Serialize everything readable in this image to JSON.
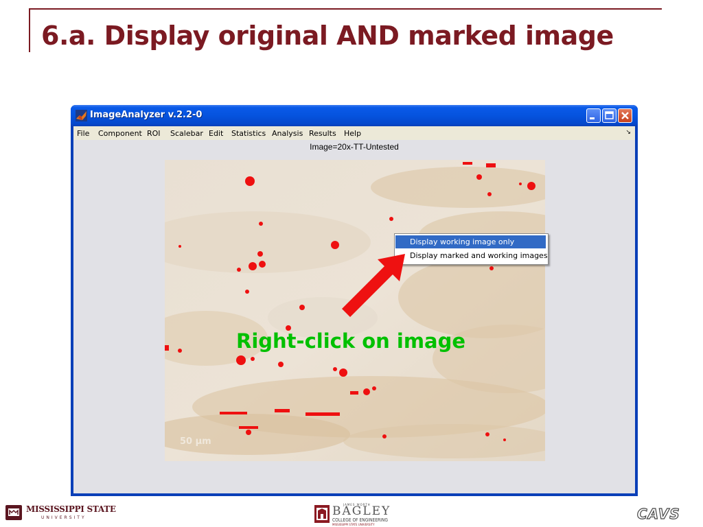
{
  "slide": {
    "title": "6.a. Display original AND marked image",
    "callout": "Right-click on image",
    "accent_color": "#7b1a22",
    "callout_color": "#00c000",
    "arrow_color": "#ee1111"
  },
  "window": {
    "title": "ImageAnalyzer v.2.2-0",
    "menu": [
      "File",
      "Component",
      "ROI",
      "Scalebar",
      "Edit",
      "Statistics",
      "Analysis",
      "Results",
      "Help"
    ],
    "image_title": "Image=20x-TT-Untested",
    "scale_label": "50 µm",
    "titlebar_color": "#0553de",
    "selection_color": "#316ac5"
  },
  "context_menu": {
    "items": [
      "Display working image only",
      "Display marked and working images"
    ],
    "selected_index": 0
  },
  "footer": {
    "msu_name": "MISSISSIPPI STATE",
    "msu_sub": "UNIVERSITY",
    "bagley_top": "JAMES WORTH",
    "bagley_name": "BAGLEY",
    "bagley_sub": "COLLEGE OF ENGINEERING",
    "bagley_sub2": "MISSISSIPPI STATE UNIVERSITY",
    "cavs": "CAVS"
  }
}
